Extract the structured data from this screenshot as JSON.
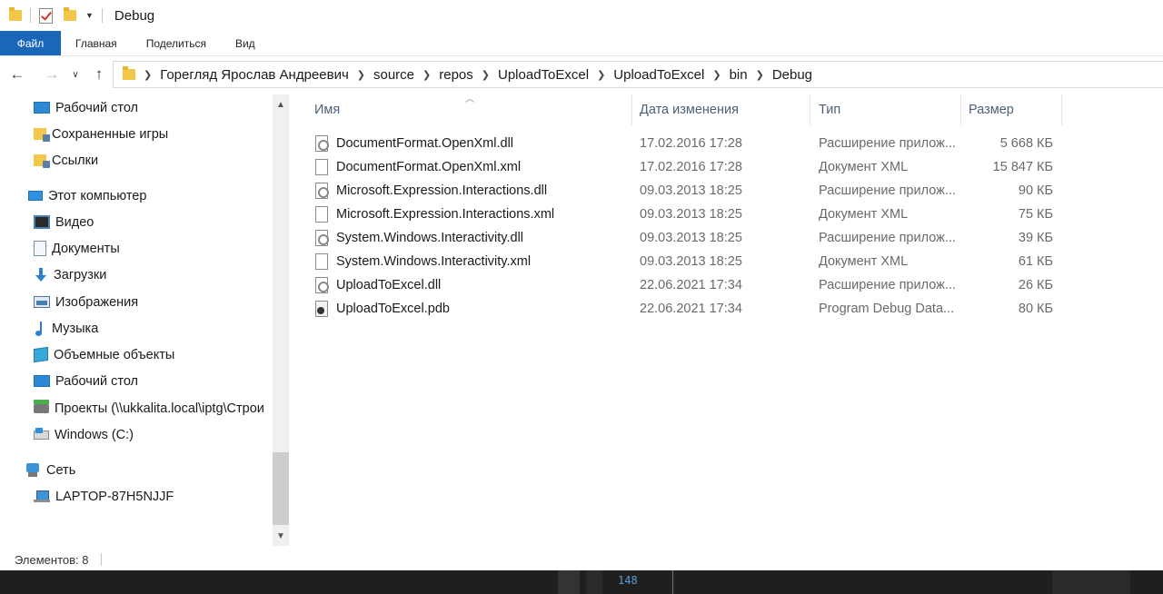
{
  "window": {
    "title": "Debug"
  },
  "ribbon": {
    "tabs": [
      "Файл",
      "Главная",
      "Поделиться",
      "Вид"
    ]
  },
  "address": {
    "crumbs": [
      "Горегляд Ярослав Андреевич",
      "source",
      "repos",
      "UploadToExcel",
      "UploadToExcel",
      "bin",
      "Debug"
    ]
  },
  "nav": {
    "items": [
      {
        "label": "Рабочий стол",
        "icon": "desktop-icon"
      },
      {
        "label": "Сохраненные игры",
        "icon": "saved-games-icon"
      },
      {
        "label": "Ссылки",
        "icon": "links-icon"
      },
      {
        "label": "Этот компьютер",
        "icon": "computer-icon"
      },
      {
        "label": "Видео",
        "icon": "video-icon"
      },
      {
        "label": "Документы",
        "icon": "documents-icon"
      },
      {
        "label": "Загрузки",
        "icon": "downloads-icon"
      },
      {
        "label": "Изображения",
        "icon": "pictures-icon"
      },
      {
        "label": "Музыка",
        "icon": "music-icon"
      },
      {
        "label": "Объемные объекты",
        "icon": "3d-objects-icon"
      },
      {
        "label": "Рабочий стол",
        "icon": "desktop-icon"
      },
      {
        "label": "Проекты (\\\\ukkalita.local\\iptg\\Строи",
        "icon": "network-drive-icon"
      },
      {
        "label": "Windows (C:)",
        "icon": "drive-icon"
      },
      {
        "label": "Сеть",
        "icon": "network-icon"
      },
      {
        "label": "LAPTOP-87H5NJJF",
        "icon": "laptop-icon"
      }
    ]
  },
  "columns": {
    "name": "Имя",
    "date": "Дата изменения",
    "type": "Тип",
    "size": "Размер"
  },
  "files": [
    {
      "name": "DocumentFormat.OpenXml.dll",
      "date": "17.02.2016 17:28",
      "type": "Расширение прилож...",
      "size": "5 668 КБ",
      "icon": "dll-file-icon"
    },
    {
      "name": "DocumentFormat.OpenXml.xml",
      "date": "17.02.2016 17:28",
      "type": "Документ XML",
      "size": "15 847 КБ",
      "icon": "xml-file-icon"
    },
    {
      "name": "Microsoft.Expression.Interactions.dll",
      "date": "09.03.2013 18:25",
      "type": "Расширение прилож...",
      "size": "90 КБ",
      "icon": "dll-file-icon"
    },
    {
      "name": "Microsoft.Expression.Interactions.xml",
      "date": "09.03.2013 18:25",
      "type": "Документ XML",
      "size": "75 КБ",
      "icon": "xml-file-icon"
    },
    {
      "name": "System.Windows.Interactivity.dll",
      "date": "09.03.2013 18:25",
      "type": "Расширение прилож...",
      "size": "39 КБ",
      "icon": "dll-file-icon"
    },
    {
      "name": "System.Windows.Interactivity.xml",
      "date": "09.03.2013 18:25",
      "type": "Документ XML",
      "size": "61 КБ",
      "icon": "xml-file-icon"
    },
    {
      "name": "UploadToExcel.dll",
      "date": "22.06.2021 17:34",
      "type": "Расширение прилож...",
      "size": "26 КБ",
      "icon": "dll-file-icon"
    },
    {
      "name": "UploadToExcel.pdb",
      "date": "22.06.2021 17:34",
      "type": "Program Debug Data...",
      "size": "80 КБ",
      "icon": "pdb-file-icon"
    }
  ],
  "status": {
    "count_text": "Элементов: 8"
  },
  "background": {
    "line_number": "148"
  },
  "colors": {
    "accent": "#1a66b8",
    "header_text": "#4c607a"
  }
}
